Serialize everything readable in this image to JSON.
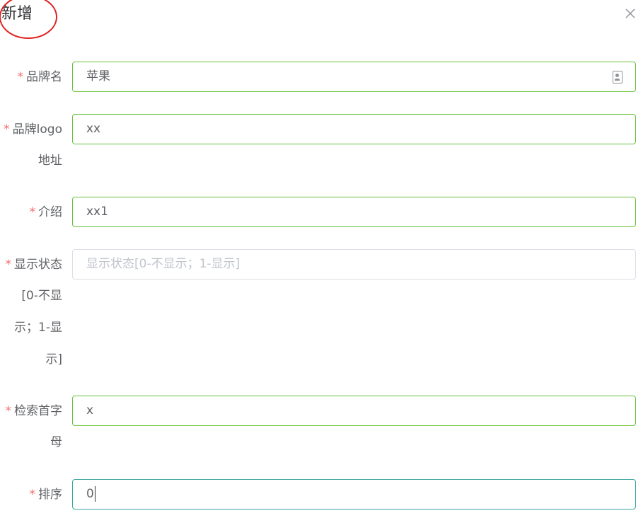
{
  "dialog": {
    "title": "新增",
    "close_icon": "close-icon"
  },
  "form": {
    "required_mark": "*",
    "fields": [
      {
        "label_lines": [
          "品牌名"
        ],
        "value": "苹果",
        "placeholder": ""
      },
      {
        "label_lines": [
          "品牌logo",
          "地址"
        ],
        "value": "xx",
        "placeholder": ""
      },
      {
        "label_lines": [
          "介绍"
        ],
        "value": "xx1",
        "placeholder": ""
      },
      {
        "label_lines": [
          "显示状态",
          "[0-不显",
          "示；1-显",
          "示]"
        ],
        "value": "",
        "placeholder": "显示状态[0-不显示；1-显示]"
      },
      {
        "label_lines": [
          "检索首字",
          "母"
        ],
        "value": "x",
        "placeholder": ""
      },
      {
        "label_lines": [
          "排序"
        ],
        "value": "0",
        "placeholder": ""
      }
    ]
  },
  "colors": {
    "required": "#f56c6c",
    "valid_border": "#67c23a",
    "annotation": "#e02020"
  }
}
